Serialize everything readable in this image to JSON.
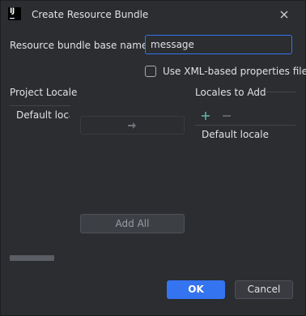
{
  "window": {
    "title": "Create Resource Bundle",
    "app_icon_text": "IJ"
  },
  "form": {
    "base_name_label": "Resource bundle base name:",
    "base_name_value": "message",
    "xml_checkbox_label": "Use XML-based properties files",
    "xml_checkbox_checked": false
  },
  "project_locales": {
    "header": "Project Locale",
    "items": [
      "Default loca"
    ]
  },
  "locales_to_add": {
    "header": "Locales to Add",
    "items": [
      "Default locale"
    ]
  },
  "buttons": {
    "add_all": "Add All",
    "ok": "OK",
    "cancel": "Cancel"
  },
  "icons": {
    "close": "close-icon",
    "move_right": "arrow-right-icon",
    "add": "plus-icon",
    "remove": "minus-icon"
  },
  "colors": {
    "background": "#2b2d30",
    "accent": "#3574f0",
    "add_icon": "#5fb8a8",
    "text": "#dfe1e5"
  }
}
